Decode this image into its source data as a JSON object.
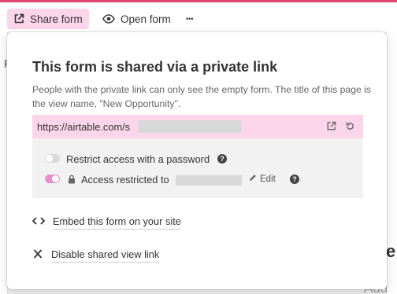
{
  "toolbar": {
    "share_form_label": "Share form",
    "open_form_label": "Open form",
    "more_glyph": "•••",
    "accent_color": "#e04870",
    "active_bg": "#fbd5ea"
  },
  "background": {
    "left_fragment": "P",
    "right_fragment_1": "e",
    "right_fragment_2": "Add"
  },
  "share_popover": {
    "title": "This form is shared via a private link",
    "description": "People with the private link can only see the empty form. The title of this page is the view name, \"New Opportunity\".",
    "link_url_prefix": "https://airtable.com/s",
    "link_actions": [
      "open-link-icon",
      "regenerate-link-icon"
    ],
    "settings": {
      "password_label": "Restrict access with a password",
      "password_enabled": false,
      "domain_label": "Access restricted to",
      "domain_enabled": true,
      "edit_label": "Edit",
      "toggle_on_color": "#e98ed0"
    },
    "embed_label": "Embed this form on your site",
    "disable_label": "Disable shared view link"
  }
}
